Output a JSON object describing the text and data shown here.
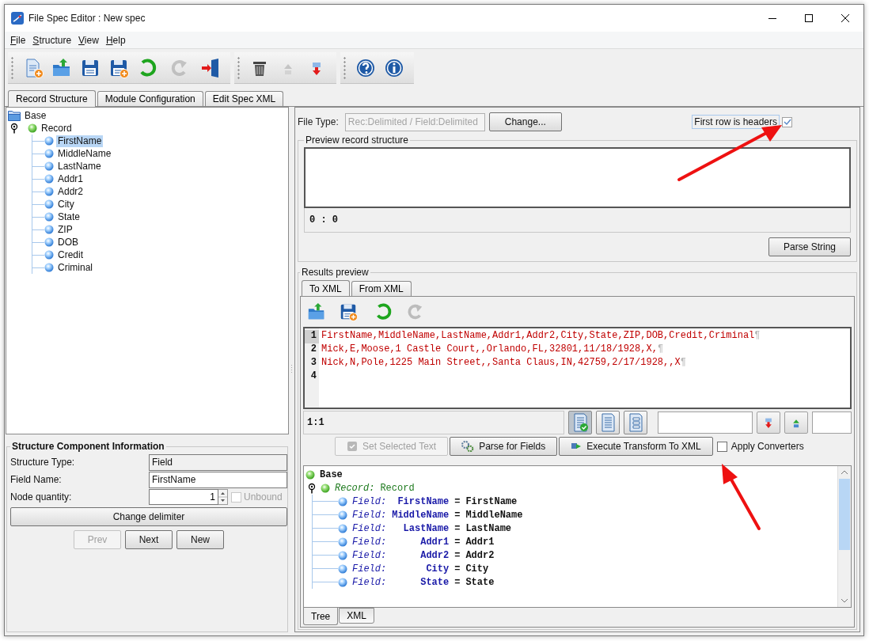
{
  "window": {
    "title": "File Spec Editor : New spec"
  },
  "menu": [
    {
      "label": "File"
    },
    {
      "label": "Structure"
    },
    {
      "label": "View"
    },
    {
      "label": "Help"
    }
  ],
  "toolbar": [
    [
      {
        "kind": "new",
        "disabled": false
      },
      {
        "kind": "open",
        "disabled": false
      },
      {
        "kind": "save",
        "disabled": false
      },
      {
        "kind": "save_as",
        "disabled": false
      },
      {
        "kind": "undo",
        "disabled": false
      },
      {
        "kind": "redo",
        "disabled": true
      },
      {
        "kind": "exit",
        "disabled": false
      }
    ],
    [
      {
        "kind": "delete",
        "disabled": false
      },
      {
        "kind": "move_up",
        "disabled": true
      },
      {
        "kind": "move_down",
        "disabled": false
      }
    ],
    [
      {
        "kind": "help",
        "disabled": false
      },
      {
        "kind": "info",
        "disabled": false
      }
    ]
  ],
  "tabs": [
    {
      "label": "Record Structure",
      "selected": true
    },
    {
      "label": "Module Configuration",
      "selected": false
    },
    {
      "label": "Edit Spec XML",
      "selected": false
    }
  ],
  "structure_tree": {
    "label": "Base",
    "children": [
      {
        "label": "Record",
        "expanded": true,
        "children": [
          {
            "label": "FirstName",
            "selected": true
          },
          {
            "label": "MiddleName",
            "selected": false
          },
          {
            "label": "LastName",
            "selected": false
          },
          {
            "label": "Addr1",
            "selected": false
          },
          {
            "label": "Addr2",
            "selected": false
          },
          {
            "label": "City",
            "selected": false
          },
          {
            "label": "State",
            "selected": false
          },
          {
            "label": "ZIP",
            "selected": false
          },
          {
            "label": "DOB",
            "selected": false
          },
          {
            "label": "Credit",
            "selected": false
          },
          {
            "label": "Criminal",
            "selected": false
          }
        ]
      }
    ]
  },
  "component_info": {
    "title": "Structure Component Information",
    "fields": [
      {
        "label": "Structure Type:",
        "value": "Field",
        "editable": false
      },
      {
        "label": "Field Name:",
        "value": "FirstName",
        "editable": true
      }
    ],
    "node_quantity": {
      "label": "Node quantity:",
      "value": "1"
    },
    "unbound": {
      "label": "Unbound",
      "checked": false,
      "disabled": true
    },
    "change_delimiter": "Change delimiter",
    "nav_buttons": [
      {
        "label": "Prev",
        "disabled": true
      },
      {
        "label": "Next",
        "disabled": false
      },
      {
        "label": "New",
        "disabled": false
      }
    ]
  },
  "file_type": {
    "label": "File Type:",
    "value": "Rec:Delimited / Field:Delimited",
    "disabled": true,
    "button": "Change..."
  },
  "first_row_headers": {
    "label": "First row is headers",
    "checked": true
  },
  "preview": {
    "title": "Preview record structure",
    "position": "0 : 0",
    "button": "Parse String"
  },
  "results": {
    "title": "Results preview",
    "tabs": [
      {
        "label": "To XML",
        "selected": true
      },
      {
        "label": "From XML",
        "selected": false
      }
    ],
    "toolbar": [
      {
        "kind": "open",
        "disabled": false
      },
      {
        "kind": "save_as",
        "disabled": false
      },
      {
        "kind": "undo",
        "disabled": false
      },
      {
        "kind": "redo",
        "disabled": true
      }
    ],
    "editor": [
      {
        "number": "1",
        "text": "FirstName,MiddleName,LastName,Addr1,Addr2,City,State,ZIP,DOB,Credit,Criminal",
        "end_mark": "¶",
        "current": true
      },
      {
        "number": "2",
        "text": "Mick,E,Moose,1 Castle Court,,Orlando,FL,32801,11/18/1928,X,",
        "end_mark": "¶",
        "current": false
      },
      {
        "number": "3",
        "text": "Nick,N,Pole,1225 Main Street,,Santa Claus,IN,42759,2/17/1928,,X",
        "end_mark": "¶",
        "current": false
      },
      {
        "number": "4",
        "current": false
      }
    ],
    "cursor": "1:1",
    "view_buttons": [
      {
        "kind": "text_view",
        "selected": true
      },
      {
        "kind": "page_view",
        "selected": false
      },
      {
        "kind": "tree_view",
        "selected": false
      }
    ],
    "actions": [
      {
        "kind": "set_text",
        "label": "Set Selected Text",
        "disabled": true
      },
      {
        "kind": "parse",
        "label": "Parse for Fields",
        "disabled": false
      },
      {
        "kind": "execute",
        "label": "Execute Transform To XML",
        "disabled": false
      }
    ],
    "apply_converters": {
      "label": "Apply Converters",
      "checked": false
    },
    "tree": {
      "label": "Base",
      "records": [
        {
          "type": "Record:",
          "name": "Record",
          "expanded": true,
          "fields": [
            {
              "type": "Field:",
              "name": "FirstName",
              "operator": "=",
              "value": "FirstName"
            },
            {
              "type": "Field:",
              "name": "MiddleName",
              "operator": "=",
              "value": "MiddleName"
            },
            {
              "type": "Field:",
              "name": "LastName",
              "operator": "=",
              "value": "LastName"
            },
            {
              "type": "Field:",
              "name": "Addr1",
              "operator": "=",
              "value": "Addr1"
            },
            {
              "type": "Field:",
              "name": "Addr2",
              "operator": "=",
              "value": "Addr2"
            },
            {
              "type": "Field:",
              "name": "City",
              "operator": "=",
              "value": "City"
            },
            {
              "type": "Field:",
              "name": "State",
              "operator": "=",
              "value": "State"
            }
          ]
        }
      ]
    },
    "bottom_tabs": [
      {
        "label": "Tree",
        "selected": true
      },
      {
        "label": "XML",
        "selected": false
      }
    ]
  }
}
